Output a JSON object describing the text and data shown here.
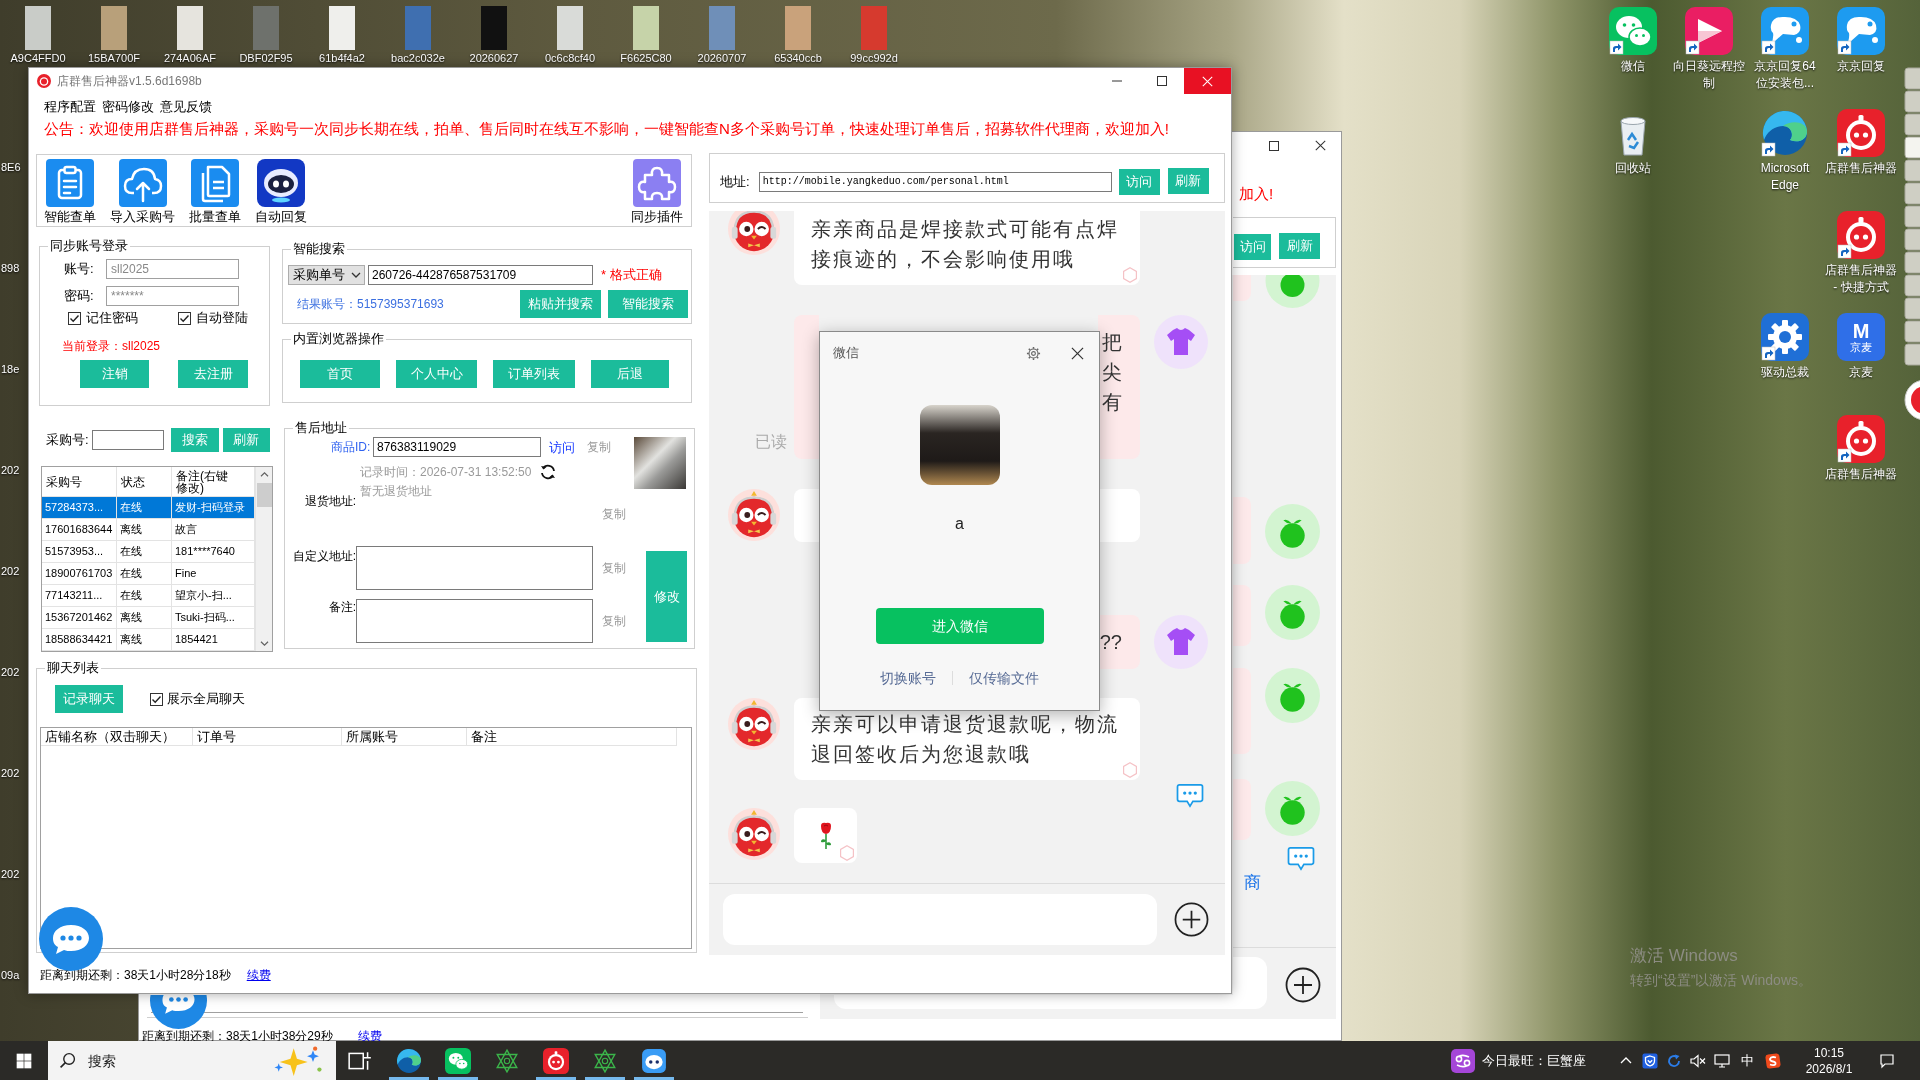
{
  "desktop": {
    "files": [
      {
        "label": "A9C4FFD0"
      },
      {
        "label": "15BA700F"
      },
      {
        "label": "274A06AF"
      },
      {
        "label": "DBF02F95"
      },
      {
        "label": "61b4f4a2"
      },
      {
        "label": "bac2c032e"
      },
      {
        "label": "20260627"
      },
      {
        "label": "0c6c8cf40"
      },
      {
        "label": "F6625C80"
      },
      {
        "label": "20260707"
      },
      {
        "label": "65340ccb"
      },
      {
        "label": "99cc992d"
      }
    ],
    "edge_labels": [
      "8E6",
      "898",
      "18e",
      "202",
      "202",
      "202",
      "202",
      "202",
      "09a"
    ],
    "shortcuts": [
      {
        "label": "微信",
        "kind": "wechat"
      },
      {
        "label": "向日葵远程控制",
        "kind": "remote"
      },
      {
        "label": "京京回复64位安装包...",
        "kind": "dog"
      },
      {
        "label": "京京回复",
        "kind": "dog"
      },
      {
        "label": "回收站",
        "kind": "bin"
      },
      {
        "label": "Microsoft Edge",
        "kind": "swirl"
      },
      {
        "label": "店群售后神器",
        "kind": "stopwatch"
      },
      {
        "label": "店群售后神器 - 快捷方式",
        "kind": "stopwatch"
      },
      {
        "label": "驱动总裁",
        "kind": "gear"
      },
      {
        "label": "京麦",
        "kind": "tile",
        "logo_text": [
          "M",
          "京麦"
        ]
      },
      {
        "label": "店群售后神器",
        "kind": "stopwatch"
      }
    ],
    "activation": {
      "title": "激活 Windows",
      "hint": "转到“设置”以激活 Windows。"
    }
  },
  "background_window": {
    "notice_tail": "加入!",
    "buttons": [
      "访问",
      "刷新"
    ],
    "link_tail": "商",
    "footer": {
      "remaining": "距离到期还剩：38天1小时38分29秒",
      "renew": "续费"
    }
  },
  "app": {
    "title": "店群售后神器v1.5.6d1698b",
    "menu": [
      "程序配置",
      "密码修改",
      "意见反馈"
    ],
    "notice": "公告：欢迎使用店群售后神器，采购号一次同步长期在线，拍单、售后同时在线互不影响，一键智能查N多个采购号订单，快速处理订单售后，招募软件代理商，欢迎加入!",
    "tools": [
      {
        "label": "智能查单",
        "kind": "clipboard"
      },
      {
        "label": "导入采购号",
        "kind": "upload"
      },
      {
        "label": "批量查单",
        "kind": "documents"
      },
      {
        "label": "自动回复",
        "kind": "robot"
      }
    ],
    "plugin": {
      "label": "同步插件"
    },
    "login": {
      "title": "同步账号登录",
      "fields": [
        {
          "label": "账号:",
          "value": "sll2025"
        },
        {
          "label": "密码:",
          "value": "*******"
        }
      ],
      "options": [
        {
          "label": "记住密码",
          "checked": true
        },
        {
          "label": "自动登陆",
          "checked": true
        }
      ],
      "current": "当前登录：sll2025",
      "buttons": [
        "注销",
        "去注册"
      ]
    },
    "smart_search": {
      "title": "智能搜索",
      "search_type": "采购单号",
      "query": "260726-442876587531709",
      "status": "* 格式正确",
      "result": "结果账号：5157395371693",
      "buttons": [
        "粘贴并搜索",
        "智能搜索"
      ]
    },
    "browser_actions": {
      "title": "内置浏览器操作",
      "buttons": [
        "首页",
        "个人中心",
        "订单列表",
        "后退"
      ]
    },
    "purchase_filter": {
      "label": "采购号:",
      "buttons": [
        "搜索",
        "刷新"
      ]
    },
    "accounts": {
      "columns": [
        "采购号",
        "状态",
        "备注(右键修改)"
      ],
      "rows": [
        {
          "cells": [
            "57284373...",
            "在线",
            "发财-扫码登录"
          ],
          "selected": true
        },
        {
          "cells": [
            "17601683644",
            "离线",
            "故言"
          ],
          "selected": false
        },
        {
          "cells": [
            "51573953...",
            "在线",
            "181****7640"
          ],
          "selected": false
        },
        {
          "cells": [
            "18900761703",
            "在线",
            "Fine"
          ],
          "selected": false
        },
        {
          "cells": [
            "77143211...",
            "在线",
            "望京小-扫..."
          ],
          "selected": false
        },
        {
          "cells": [
            "15367201462",
            "离线",
            "Tsuki-扫码..."
          ],
          "selected": false
        },
        {
          "cells": [
            "18588634421",
            "离线",
            "1854421"
          ],
          "selected": false
        }
      ]
    },
    "after_sale": {
      "title": "售后地址",
      "product_label": "商品ID:",
      "product_id": "876383119029",
      "visit": "访问",
      "record_time": "记录时间：2026-07-31 13:52:50",
      "no_address": "暂无退货地址",
      "return_label": "退货地址:",
      "custom_label": "自定义地址:",
      "note_label": "备注:",
      "copy": [
        "复制",
        "复制",
        "复制",
        "复制"
      ],
      "modify": "修改"
    },
    "chat_list": {
      "title": "聊天列表",
      "record_button": "记录聊天",
      "show_all": {
        "label": "展示全局聊天",
        "checked": true
      },
      "columns": [
        "店铺名称（双击聊天）",
        "订单号",
        "所属账号",
        "备注"
      ]
    },
    "footer": {
      "remaining": "距离到期还剩：38天1小时28分18秒",
      "renew": "续费"
    },
    "browser": {
      "address_label": "地址:",
      "url": "http://mobile.yangkeduo.com/personal.html",
      "buttons": [
        "访问",
        "刷新"
      ],
      "messages": [
        {
          "outgoing": false,
          "kind": "text",
          "text": "亲亲商品是焊接款式可能有点焊接痕迹的，不会影响使用哦"
        },
        {
          "outgoing": true,
          "kind": "partial",
          "fragments": [
            "把",
            "尖",
            "有"
          ],
          "receipt": "已读"
        },
        {
          "outgoing": false,
          "kind": "hidden"
        },
        {
          "outgoing": true,
          "kind": "partial",
          "fragments": [
            "??"
          ]
        },
        {
          "outgoing": false,
          "kind": "text",
          "text": "亲亲可以申请退货退款呢，物流退回签收后为您退款哦",
          "action_icon": true
        },
        {
          "outgoing": false,
          "kind": "emoji"
        }
      ]
    }
  },
  "wechat_dialog": {
    "title": "微信",
    "name": "a",
    "button": "进入微信",
    "links": [
      "切换账号",
      "仅传输文件"
    ]
  },
  "taskbar": {
    "search": {
      "placeholder": "搜索"
    },
    "apps": [
      {
        "kind": "taskview",
        "running": false
      },
      {
        "kind": "swirl",
        "running": true
      },
      {
        "kind": "wechat",
        "running": true
      },
      {
        "kind": "star",
        "running": false
      },
      {
        "kind": "stopwatch",
        "running": true
      },
      {
        "kind": "star",
        "running": true
      },
      {
        "kind": "chatbot",
        "running": true
      }
    ],
    "widget": "今日最旺：巨蟹座",
    "ime": "中",
    "time": "10:15",
    "date": "2026/8/1"
  }
}
